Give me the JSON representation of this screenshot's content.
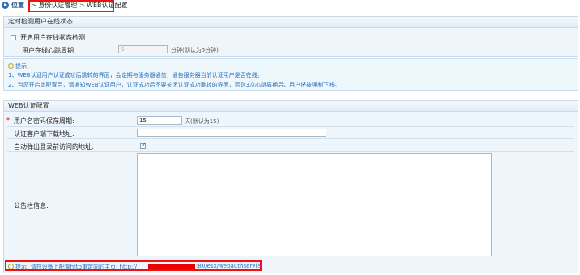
{
  "breadcrumb": {
    "position_label": "位置",
    "separator": ">",
    "items": [
      "身份认证管理",
      "WEB认证配置"
    ]
  },
  "online_check": {
    "title": "定时检测用户在线状态",
    "enable_label": "开启用户在线状态检测",
    "enable_checked": false,
    "heartbeat_label": "用户在线心跳周期:",
    "heartbeat_value": "5",
    "heartbeat_unit_hint": "分钟(默认为5分钟)"
  },
  "tips": {
    "title": "提示:",
    "line1": "1、WEB认证用户认证成功后跳转的界面，会定期与服务器通信，通告服务器当前认证用户是否在线。",
    "line2": "2、当您开启此配置后，请通知WEB认证用户，认证成功后不要关闭认证成功跳转的界面，否则3次心跳周期后，用户将被强制下线。"
  },
  "web_auth": {
    "title": "WEB认证配置",
    "required_mark": "*",
    "password_period_label": "用户名密码保存周期:",
    "password_period_value": "15",
    "password_period_hint": "天(默认为15)",
    "client_download_label": "认证客户端下载地址:",
    "client_download_value": "",
    "auto_popup_label": "自动弹出登录前访问的地址:",
    "auto_popup_checked": true,
    "notice_label": "公告栏信息:",
    "notice_value": ""
  },
  "bottom_tip": {
    "prefix": "提示: 请在设备上配置http重定向的主页: http://",
    "suffix": ":80/esx/webauthservlet"
  },
  "colors": {
    "accent": "#2f6fbf",
    "highlight_border": "#ee1111",
    "redaction": "#e60000",
    "panel_bg": "#eef5fb"
  }
}
